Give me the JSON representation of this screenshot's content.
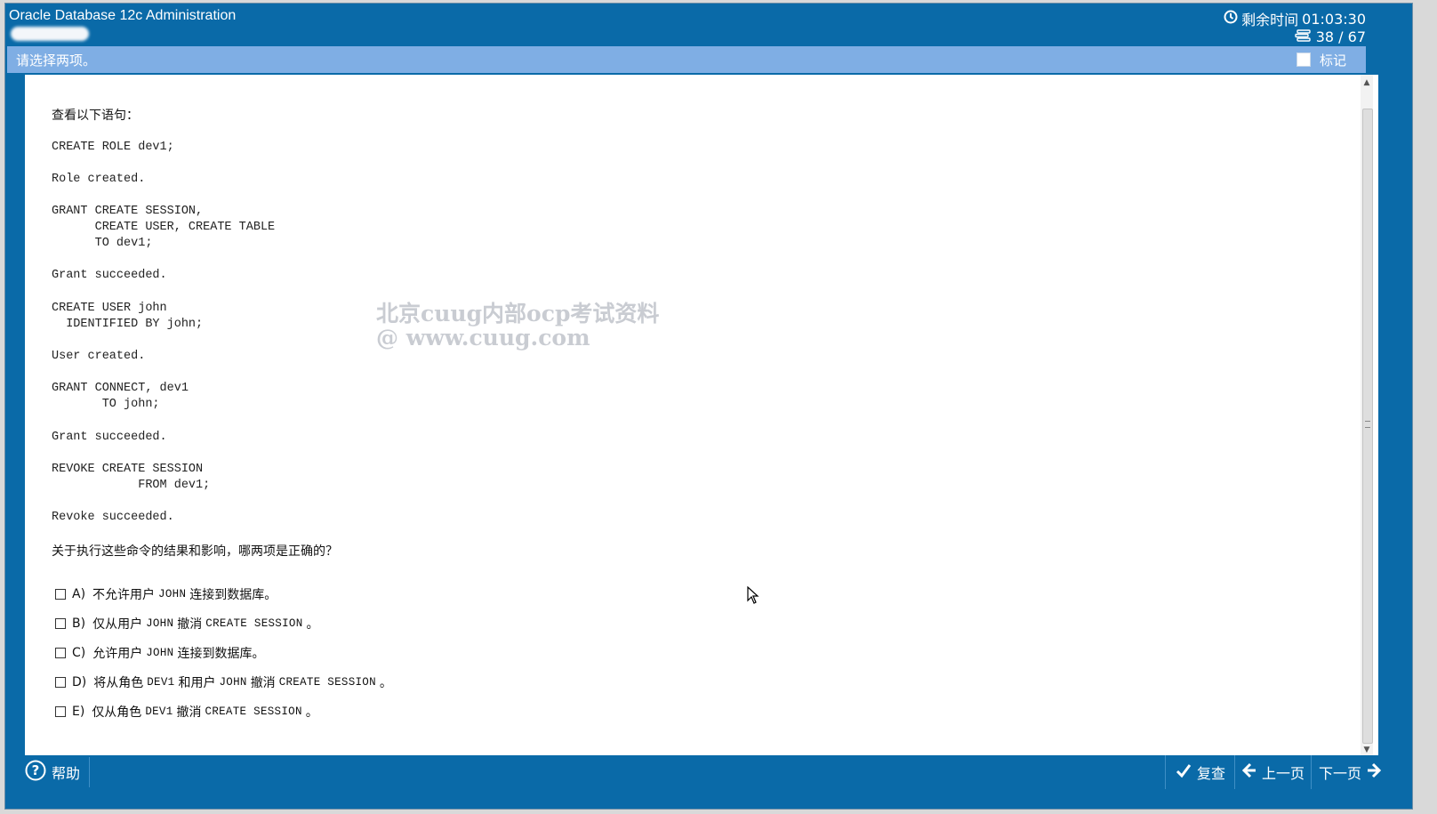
{
  "header": {
    "app_title": "Oracle Database 12c Administration",
    "timer_label": "剩余时间",
    "timer_value": "01:03:30",
    "progress": "38 / 67"
  },
  "instruction": {
    "text": "请选择两项。",
    "mark_label": "标记"
  },
  "question": {
    "intro": "查看以下语句：",
    "code_blocks": [
      "CREATE ROLE dev1;",
      "Role created.",
      "GRANT CREATE SESSION,\n      CREATE USER, CREATE TABLE\n      TO dev1;",
      "Grant succeeded.",
      "CREATE USER john\n  IDENTIFIED BY john;",
      "User created.",
      "GRANT CONNECT, dev1\n       TO john;",
      "Grant succeeded.",
      "REVOKE CREATE SESSION\n            FROM dev1;",
      "Revoke succeeded."
    ],
    "prompt": "关于执行这些命令的结果和影响，哪两项是正确的？",
    "options": [
      {
        "letter": "A)",
        "parts": [
          "不允许用户",
          "JOHN",
          "连接到数据库。"
        ]
      },
      {
        "letter": "B)",
        "parts": [
          "仅从用户",
          "JOHN",
          "撤消",
          "CREATE SESSION",
          "。"
        ]
      },
      {
        "letter": "C)",
        "parts": [
          "允许用户",
          "JOHN",
          "连接到数据库。"
        ]
      },
      {
        "letter": "D)",
        "parts": [
          "将从角色",
          "DEV1",
          "和用户",
          "JOHN",
          "撤消",
          "CREATE SESSION",
          "。"
        ]
      },
      {
        "letter": "E)",
        "parts": [
          "仅从角色",
          "DEV1",
          "撤消",
          "CREATE SESSION",
          "。"
        ]
      }
    ]
  },
  "watermark": {
    "line1": "北京cuug内部ocp考试资料",
    "line2": "@ www.cuug.com"
  },
  "footer": {
    "help_label": "帮助",
    "review_label": "复查",
    "prev_label": "上一页",
    "next_label": "下一页"
  },
  "colors": {
    "frame": "#0a6aa8",
    "instruction_bar": "#7faee4",
    "content_bg": "#ffffff"
  }
}
